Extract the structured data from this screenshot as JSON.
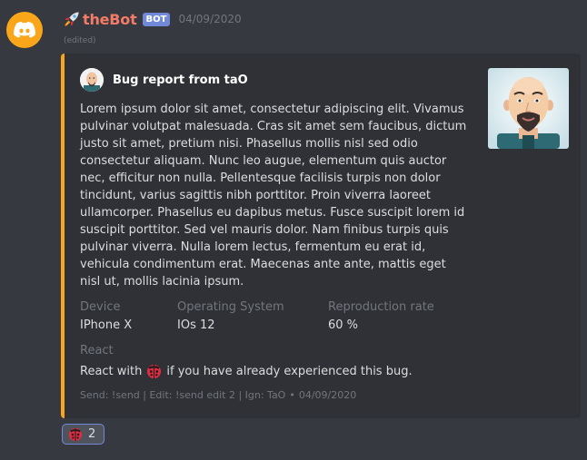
{
  "message": {
    "username": "theBot",
    "bot_tag": "BOT",
    "timestamp": "04/09/2020",
    "edited": "(edited)",
    "avatar_icon": "discord-logo-icon",
    "username_color": "#f47b67"
  },
  "embed": {
    "accent_color": "#faa61a",
    "author": "Bug report from taO",
    "description": "Lorem ipsum dolor sit amet, consectetur adipiscing elit. Vivamus pulvinar volutpat malesuada. Cras sit amet sem faucibus, dictum justo sit amet, pretium nisi. Phasellus mollis nisl sed odio consectetur aliquam. Nunc leo augue, elementum quis auctor nec, efficitur non nulla. Pellentesque facilisis turpis non dolor tincidunt, varius sagittis nibh porttitor. Proin viverra laoreet ullamcorper. Phasellus eu dapibus metus. Fusce suscipit lorem id suscipit porttitor. Sed vel mauris dolor. Nam finibus turpis quis pulvinar viverra. Nulla lorem lectus, fermentum eu erat id, vehicula condimentum erat. Maecenas ante ante, mattis eget nisl ut, mollis lacinia ipsum.",
    "fields": [
      {
        "name": "Device",
        "value": "IPhone X"
      },
      {
        "name": "Operating System",
        "value": "IOs 12"
      },
      {
        "name": "Reproduction rate",
        "value": "60 %"
      }
    ],
    "react_field": {
      "name": "React",
      "value_before": "React with",
      "value_after": "if you have already experienced this bug."
    },
    "footer": {
      "text": "Send: !send | Edit: !send edit 2 | Ign: TaO",
      "separator": "•",
      "timestamp": "04/09/2020"
    }
  },
  "reaction": {
    "icon": "ladybug-icon",
    "count": "2"
  }
}
